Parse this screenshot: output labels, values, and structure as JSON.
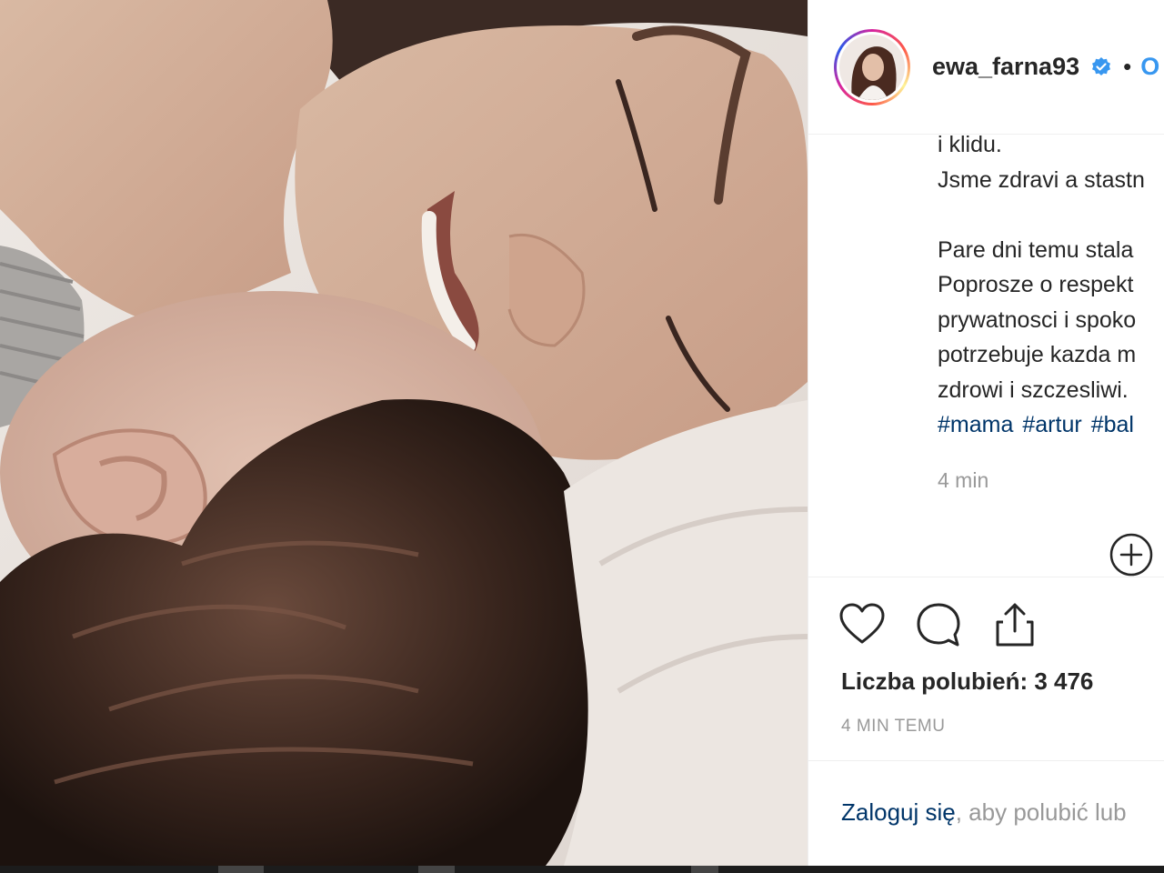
{
  "post": {
    "photo_icon": "photo-image",
    "account": {
      "username": "ewa_farna93",
      "verified_icon": "verified-badge-icon",
      "separator": "•",
      "follow_label": "O"
    },
    "caption": {
      "lines_top": [
        "i klidu.",
        "Jsme zdravi a stastn"
      ],
      "lines_bottom": [
        "Pare dni temu stala",
        "Poprosze o respekt",
        "prywatnosci i spoko",
        "potrzebuje kazda m",
        "zdrowi i szczesliwi."
      ],
      "hashtags": [
        "#mama",
        "#artur",
        "#bal"
      ],
      "time": "4 min"
    },
    "actions": {
      "like_icon": "heart-icon",
      "comment_icon": "comment-icon",
      "share_icon": "share-icon",
      "more_icon": "plus-circle-icon"
    },
    "likes_text": "Liczba polubień: 3 476",
    "time_ago": "4 MIN TEMU",
    "login": {
      "link": "Zaloguj się",
      "rest": ", aby polubić lub"
    }
  },
  "colors": {
    "link": "#003569",
    "follow": "#3897f0",
    "muted": "#999999",
    "verified": "#3897f0"
  }
}
